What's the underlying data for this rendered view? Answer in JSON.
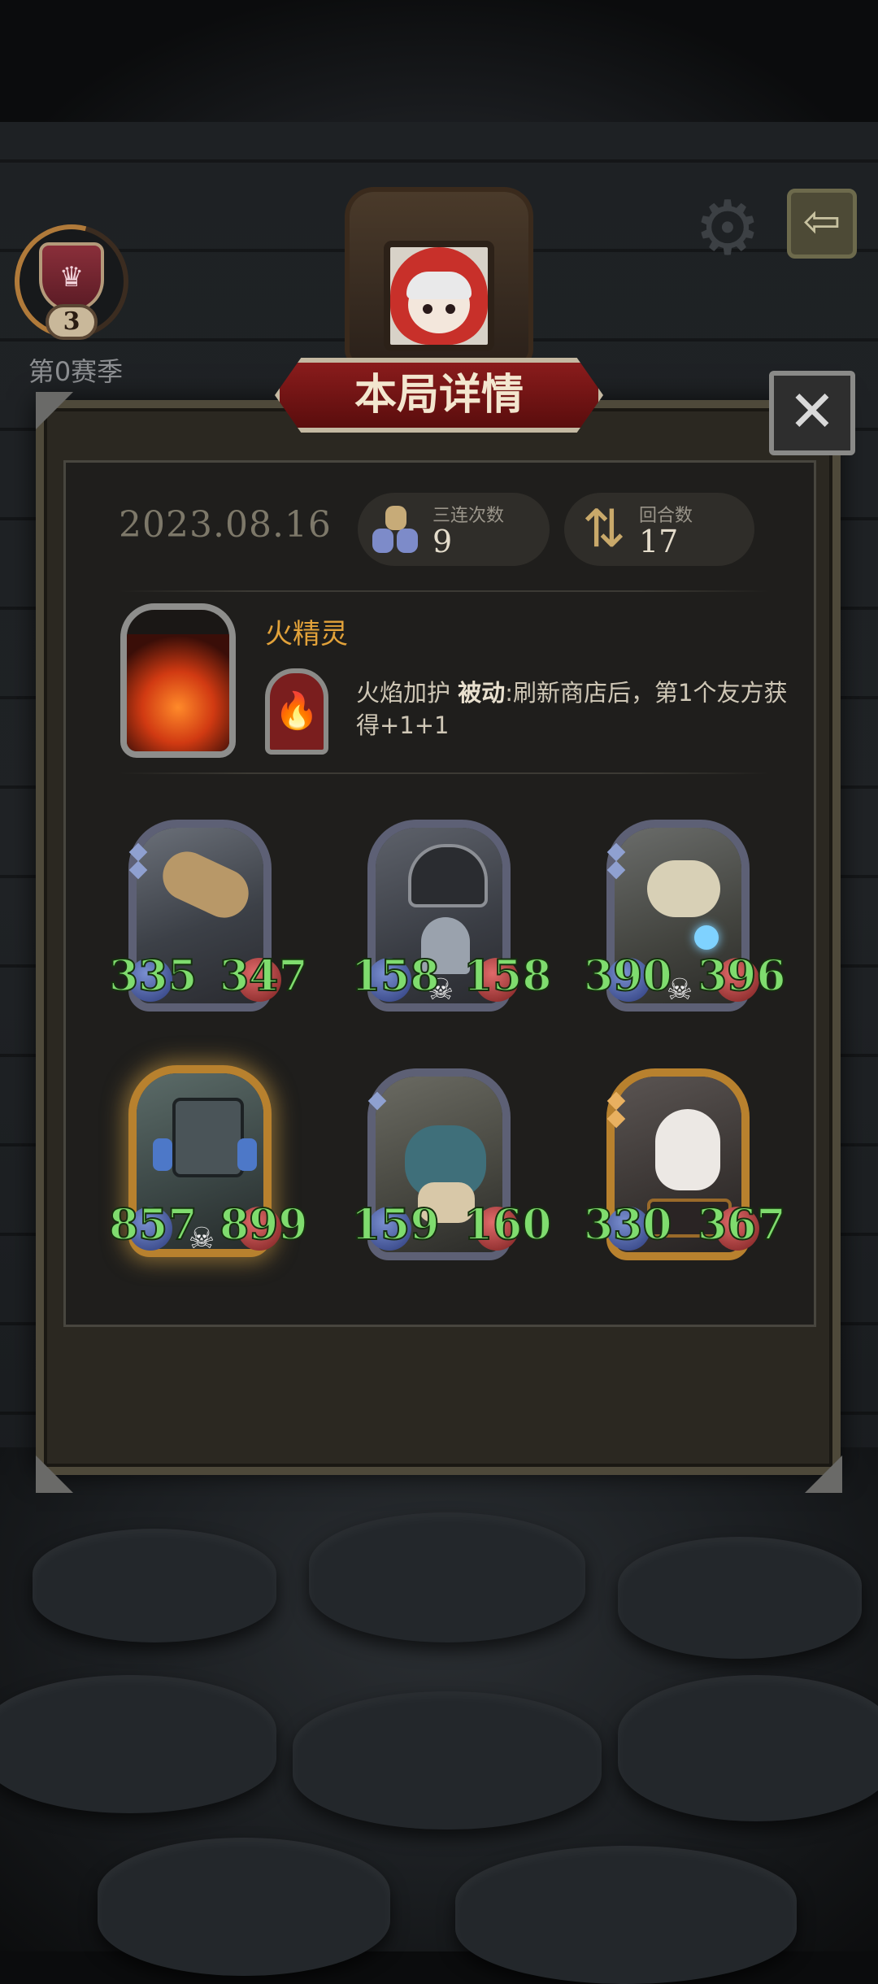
{
  "season": {
    "level": "3",
    "label": "第0赛季"
  },
  "header_icons": {
    "settings": "gear-icon",
    "back": "back-arrow-icon"
  },
  "dialog": {
    "title": "本局详情",
    "close_icon": "close-icon",
    "date": "2023.08.16",
    "stats": [
      {
        "label": "三连次数",
        "value": "9",
        "icon": "triple-icon"
      },
      {
        "label": "回合数",
        "value": "17",
        "icon": "rounds-icon"
      }
    ],
    "relic": {
      "name": "火精灵",
      "skill_name": "火焰加护",
      "skill_type": "被动",
      "skill_desc": ":刷新商店后，第1个友方获得+1+1"
    },
    "units": [
      {
        "atk": "335",
        "hp": "347",
        "frame": "silver"
      },
      {
        "atk": "158",
        "hp": "158",
        "frame": "silver"
      },
      {
        "atk": "390",
        "hp": "396",
        "frame": "silver"
      },
      {
        "atk": "857",
        "hp": "899",
        "frame": "gold"
      },
      {
        "atk": "159",
        "hp": "160",
        "frame": "silver"
      },
      {
        "atk": "330",
        "hp": "367",
        "frame": "gold"
      }
    ]
  },
  "colors": {
    "stat_green": "#7fdc6e",
    "relic_name": "#e2a23a",
    "banner_red": "#8a1c1c"
  }
}
